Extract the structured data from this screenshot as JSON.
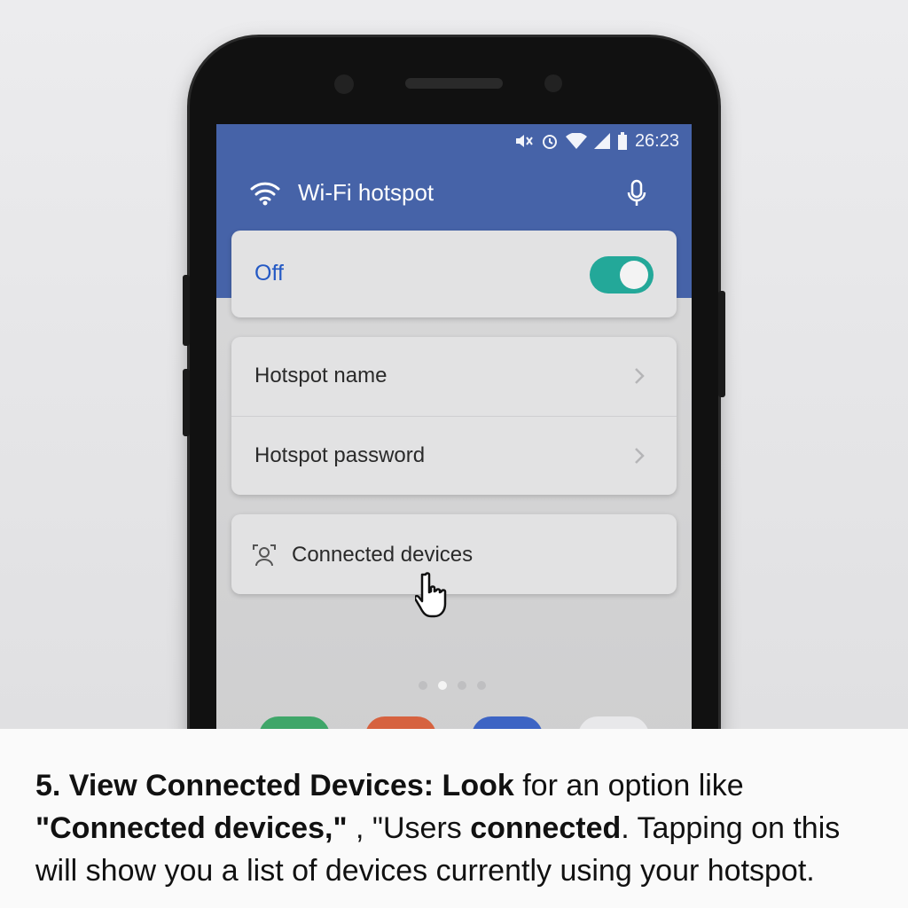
{
  "status_bar": {
    "time": "26:23"
  },
  "app_bar": {
    "title": "Wi-Fi hotspot",
    "icons": [
      "wifi-icon",
      "microphone-icon"
    ]
  },
  "hotspot_toggle": {
    "label": "Off",
    "state": "on-appearance"
  },
  "settings": {
    "items": [
      {
        "label": "Hotspot name"
      },
      {
        "label": "Hotspot password"
      }
    ]
  },
  "connected": {
    "label": "Connected devices"
  },
  "page_indicator": {
    "count": 4,
    "active_index": 1
  },
  "caption": {
    "step": "5. View Connected Devices: Look",
    "part2": " for an option like ",
    "bold2": "\"Connected devices,\"",
    "part3": " , \"Users ",
    "bold3": "connected",
    "part4": ". Tapping on this will show you a list of devices currently using your hotspot."
  },
  "colors": {
    "app_bar": "#4663a8",
    "toggle": "#23a899",
    "off_text": "#2459c4"
  }
}
